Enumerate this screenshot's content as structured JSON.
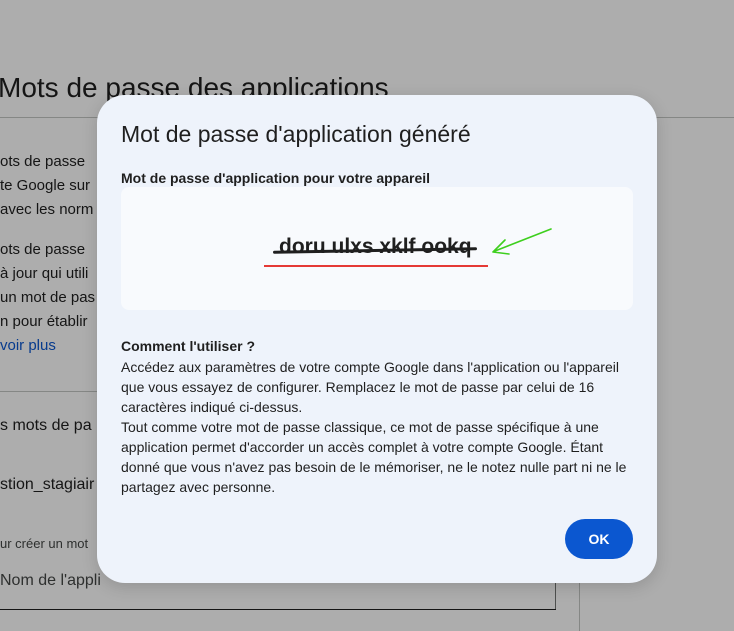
{
  "background": {
    "page_title": "Mots de passe des applications",
    "lines": [
      "ots de passe",
      "te Google sur",
      "avec les norm",
      "ots de passe",
      "à jour qui utili",
      "un mot de pas",
      "n pour établir"
    ],
    "see_more_link": "voir plus",
    "section_title": "s mots de pa",
    "app_entry": "stion_stagiair",
    "create_hint": "ur créer un mot",
    "app_name_placeholder": "Nom de l'appli"
  },
  "dialog": {
    "title": "Mot de passe d'application généré",
    "password_label": "Mot de passe d'application pour votre appareil",
    "password_value": "doru ulxs xklf ookq",
    "howto_title": "Comment l'utiliser ?",
    "howto_paragraph_1": "Accédez aux paramètres de votre compte Google dans l'application ou l'appareil que vous essayez de configurer. Remplacez le mot de passe par celui de 16 caractères indiqué ci-dessus.",
    "howto_paragraph_2": "Tout comme votre mot de passe classique, ce mot de passe spécifique à une application permet d'accorder un accès complet à votre compte Google. Étant donné que vous n'avez pas besoin de le mémoriser, ne le notez nulle part ni ne le partagez avec personne.",
    "ok_label": "OK"
  },
  "colors": {
    "accent": "#0b57d0",
    "dialog_bg": "#eef3fb",
    "annotation_arrow": "#3ecf1e",
    "annotation_underline": "#e53935"
  },
  "icons": {
    "annotation": "arrow-pointer-icon"
  }
}
